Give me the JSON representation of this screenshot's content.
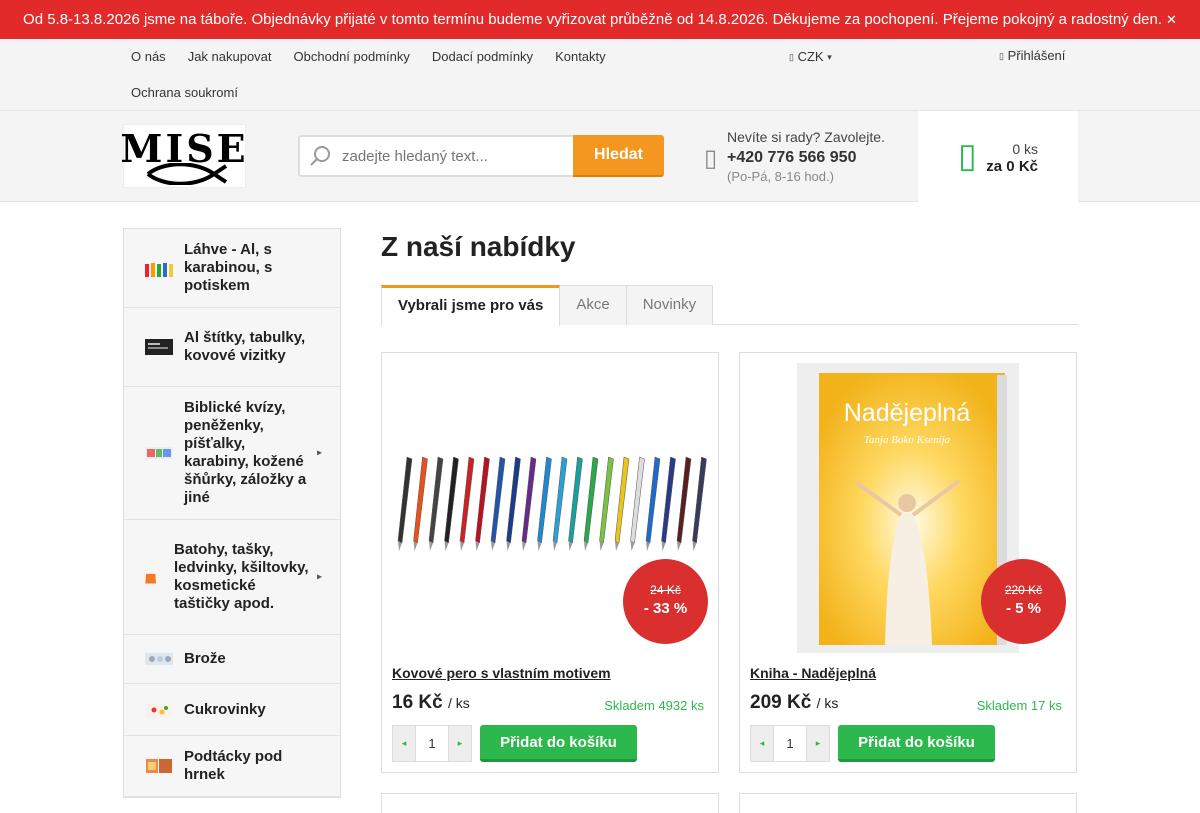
{
  "banner": {
    "text": "Od 5.8-13.8.2026 jsme na táboře. Objednávky přijaté v tomto termínu budeme vyřizovat průběžně od 14.8.2026. Děkujeme za pochopení. Přejeme pokojný a radostný den.",
    "close_icon": "close-icon"
  },
  "topnav": {
    "links": [
      "O nás",
      "Jak nakupovat",
      "Obchodní podmínky",
      "Dodací podmínky",
      "Kontakty",
      "Ochrana soukromí"
    ],
    "currency": "CZK",
    "login": "Přihlášení"
  },
  "header": {
    "logo_text": "MISE",
    "search_placeholder": "zadejte hledaný text...",
    "search_button": "Hledat",
    "contact_question": "Nevíte si rady? Zavolejte.",
    "phone": "+420 776 566 950",
    "hours": "(Po-Pá, 8-16 hod.)",
    "cart_count": "0 ks",
    "cart_total": "za 0 Kč"
  },
  "sidebar": {
    "categories": [
      {
        "label": "Láhve - Al, s karabinou, s potiskem",
        "has_sub": false
      },
      {
        "label": "Al štítky, tabulky, kovové vizitky",
        "has_sub": false
      },
      {
        "label": "Biblické kvízy, peněženky, píšťalky, karabiny, kožené šňůrky, záložky a jiné",
        "has_sub": true
      },
      {
        "label": "Batohy, tašky, ledvinky, kšiltovky, kosmetické taštičky apod.",
        "has_sub": true
      },
      {
        "label": "Brože",
        "has_sub": false
      },
      {
        "label": "Cukrovinky",
        "has_sub": false
      },
      {
        "label": "Podtácky pod hrnek",
        "has_sub": false
      }
    ]
  },
  "main": {
    "title": "Z naší nabídky",
    "tabs": [
      "Vybrali jsme pro vás",
      "Akce",
      "Novinky"
    ],
    "products": [
      {
        "name": "Kovové pero s vlastním motivem",
        "price": "16 Kč",
        "unit": "/ ks",
        "old_price": "24 Kč",
        "discount": "- 33 %",
        "stock": "Skladem 4932 ks",
        "qty": "1",
        "add_label": "Přidat do košíku"
      },
      {
        "name": "Kniha - Nadějeplná",
        "price": "209 Kč",
        "unit": "/ ks",
        "old_price": "220 Kč",
        "discount": "- 5 %",
        "stock": "Skladem 17 ks",
        "qty": "1",
        "add_label": "Přidat do košíku",
        "cover_title": "Nadějeplná",
        "cover_author": "Tanja Boko Ksenija"
      }
    ]
  },
  "colors": {
    "accent": "#f39720",
    "banner": "#e22a2a",
    "green": "#2db84d",
    "discount": "#d9302f"
  }
}
